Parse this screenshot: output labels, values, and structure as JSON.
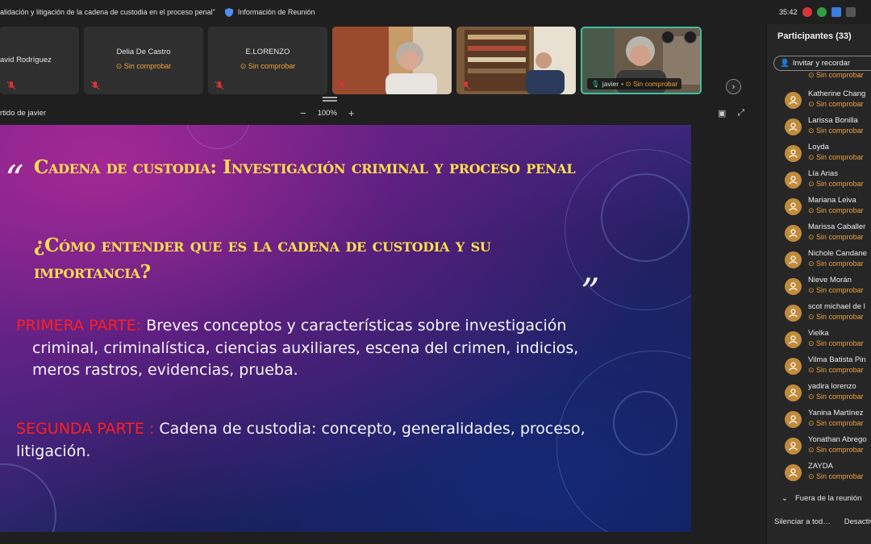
{
  "titlebar": {
    "meeting_title": "alidación y litigación de la cadena de custodia en el proceso penal\"",
    "info_label": "Información de Reunión",
    "timer": "35:42"
  },
  "strip": {
    "tiles": [
      {
        "name": "avid Rodríguez",
        "status": ""
      },
      {
        "name": "Delia De Castro",
        "status": "Sin comprobar"
      },
      {
        "name": "E.LORENZO",
        "status": "Sin comprobar"
      }
    ],
    "active_tag": {
      "name": "javier",
      "status": "Sin comprobar"
    }
  },
  "share": {
    "label": "rtido de javier",
    "zoom_minus": "−",
    "zoom": "100%",
    "zoom_plus": "+"
  },
  "slide": {
    "title": "Cadena de custodia:  Investigación criminal y proceso penal",
    "subtitle": "¿Cómo entender que es la cadena de custodia y su importancia?",
    "part1_label": "PRIMERA PARTE:",
    "part1_line1": " Breves conceptos y características sobre investigación",
    "part1_line2": "criminal, criminalística, ciencias auxiliares, escena del crimen, indicios, meros rastros, evidencias, prueba.",
    "part2_label": "SEGUNDA PARTE :",
    "part2_text": " Cadena de custodia: concepto, generalidades, proceso, litigación."
  },
  "participants": {
    "header": "Participantes (33)",
    "invite_label": "Invitar y recordar",
    "status_text": "Sin comprobar",
    "names": [
      "Katherine Chang",
      "Larissa Bonilla",
      "Loyda",
      "Lía Arias",
      "Mariana Leiva",
      "Marissa Caballer",
      "Nichole Candane",
      "Nieve Morán",
      "scot michael de l",
      "Vielka",
      "Vilma Batista Pin",
      "yadira lorenzo",
      "Yanina Martínez",
      "Yonathan Abrego",
      "ZAYDA"
    ],
    "out_of_meeting": "Fuera de la reunión",
    "mute_all": "Silenciar a tod…",
    "disable": "Desactiv"
  },
  "colors": {
    "slide_yellow": "#ffe14a",
    "slide_red": "#ff1f1f",
    "warning": "#f0a13a",
    "active_border": "#3fbf9f",
    "avatar": "#c18b3c"
  }
}
